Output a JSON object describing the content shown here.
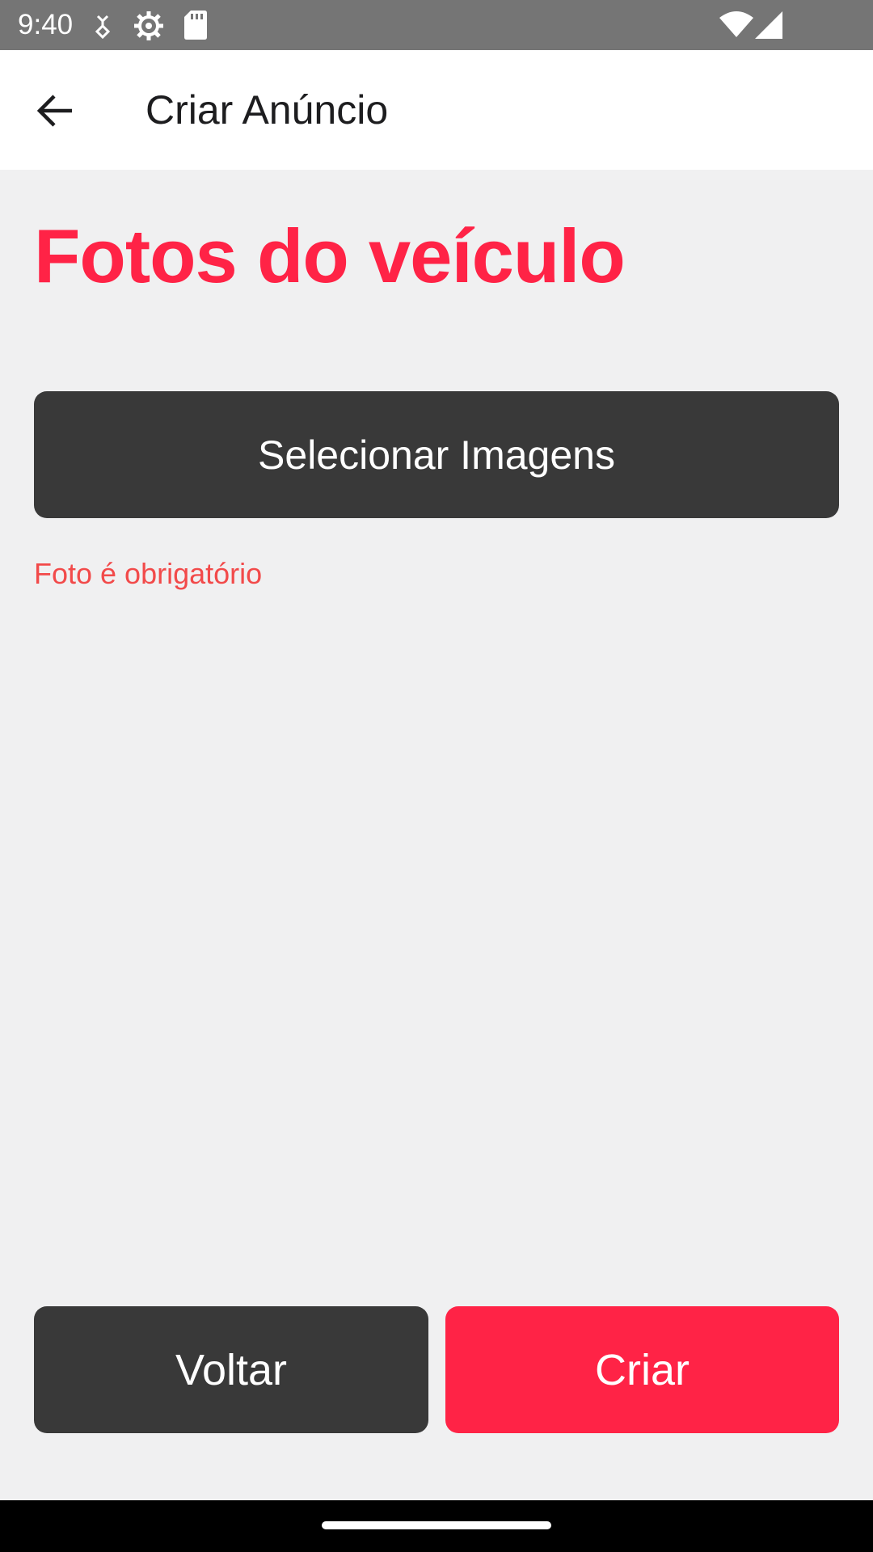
{
  "status_bar": {
    "time": "9:40",
    "icons": [
      "usb-debug-icon",
      "settings-gear-icon",
      "sd-card-icon",
      "wifi-icon",
      "cell-signal-icon"
    ]
  },
  "app_bar": {
    "title": "Criar Anúncio",
    "back_icon": "arrow-left-icon"
  },
  "content": {
    "section_title": "Fotos do veículo",
    "select_images_label": "Selecionar Imagens",
    "error_message": "Foto é obrigatório"
  },
  "footer": {
    "back_label": "Voltar",
    "create_label": "Criar"
  },
  "colors": {
    "accent": "#ff2346",
    "dark_button": "#393939",
    "error": "#f24a4a",
    "background": "#f0f0f1",
    "status_bar": "#757575"
  }
}
